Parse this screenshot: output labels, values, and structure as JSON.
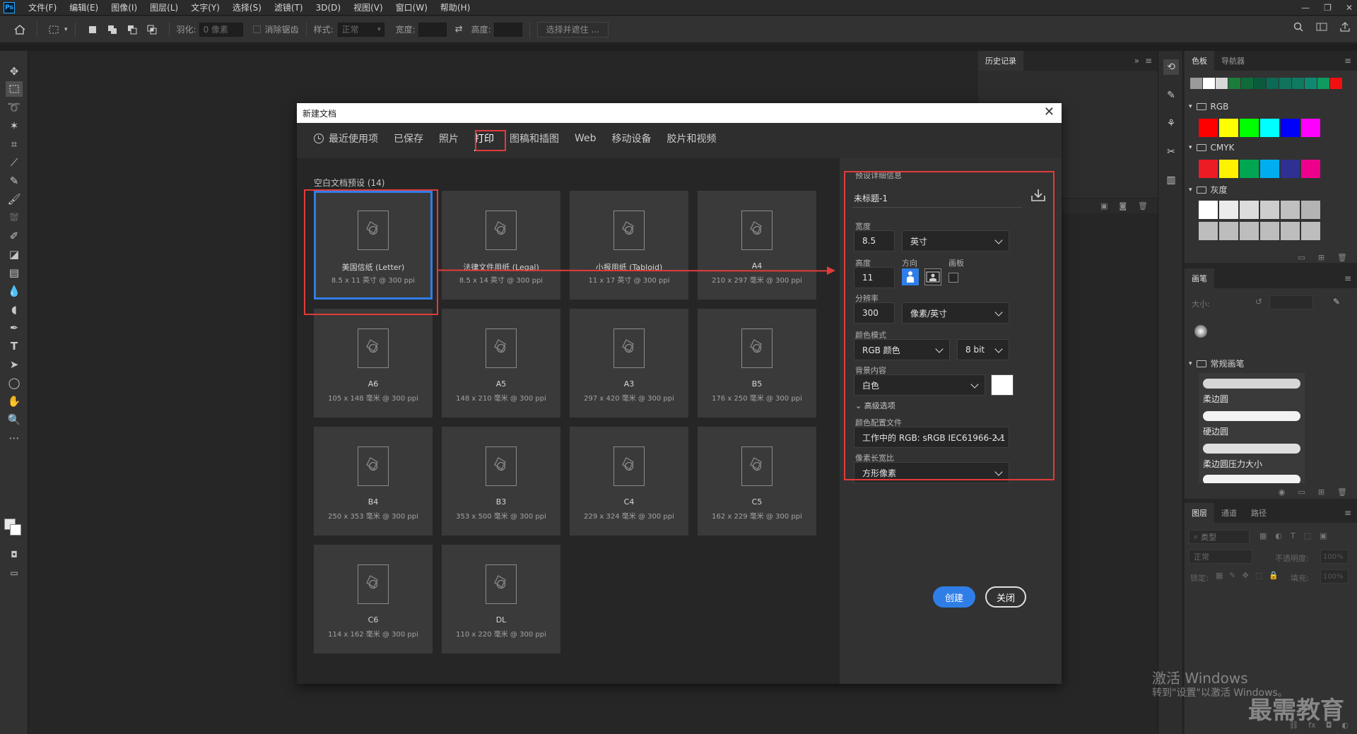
{
  "menubar": {
    "logo": "Ps",
    "items": [
      "文件(F)",
      "编辑(E)",
      "图像(I)",
      "图层(L)",
      "文字(Y)",
      "选择(S)",
      "滤镜(T)",
      "3D(D)",
      "视图(V)",
      "窗口(W)",
      "帮助(H)"
    ],
    "controls": [
      "—",
      "❐",
      "✕"
    ]
  },
  "options": {
    "feather_label": "羽化:",
    "feather_value": "0 像素",
    "antialias_label": "消除锯齿",
    "style_label": "样式:",
    "style_value": "正常",
    "width_label": "宽度:",
    "height_label": "高度:",
    "select_mask_button": "选择并遮住 ..."
  },
  "dialog": {
    "title": "新建文档",
    "tabs": [
      "最近使用项",
      "已保存",
      "照片",
      "打印",
      "图稿和插图",
      "Web",
      "移动设备",
      "胶片和视频"
    ],
    "active_tab": "打印",
    "preset_header": "空白文档预设 (14)",
    "presets": [
      {
        "name": "美国信纸 (Letter)",
        "size": "8.5 x 11 英寸 @ 300 ppi"
      },
      {
        "name": "法律文件用纸 (Legal)",
        "size": "8.5 x 14 英寸 @ 300 ppi"
      },
      {
        "name": "小报用纸 (Tabloid)",
        "size": "11 x 17 英寸 @ 300 ppi"
      },
      {
        "name": "A4",
        "size": "210 x 297 毫米 @ 300 ppi"
      },
      {
        "name": "A6",
        "size": "105 x 148 毫米 @ 300 ppi"
      },
      {
        "name": "A5",
        "size": "148 x 210 毫米 @ 300 ppi"
      },
      {
        "name": "A3",
        "size": "297 x 420 毫米 @ 300 ppi"
      },
      {
        "name": "B5",
        "size": "176 x 250 毫米 @ 300 ppi"
      },
      {
        "name": "B4",
        "size": "250 x 353 毫米 @ 300 ppi"
      },
      {
        "name": "B3",
        "size": "353 x 500 毫米 @ 300 ppi"
      },
      {
        "name": "C4",
        "size": "229 x 324 毫米 @ 300 ppi"
      },
      {
        "name": "C5",
        "size": "162 x 229 毫米 @ 300 ppi"
      },
      {
        "name": "C6",
        "size": "114 x 162 毫米 @ 300 ppi"
      },
      {
        "name": "DL",
        "size": "110 x 220 毫米 @ 300 ppi"
      }
    ],
    "details": {
      "header": "预设详细信息",
      "doc_name": "未标题-1",
      "width_label": "宽度",
      "width_value": "8.5",
      "width_unit": "英寸",
      "height_label": "高度",
      "height_value": "11",
      "orientation_label": "方向",
      "artboard_label": "画板",
      "resolution_label": "分辨率",
      "resolution_value": "300",
      "resolution_unit": "像素/英寸",
      "color_mode_label": "颜色模式",
      "color_mode_value": "RGB 颜色",
      "bit_depth": "8 bit",
      "bg_label": "背景内容",
      "bg_value": "白色",
      "advanced_label": "高级选项",
      "profile_label": "颜色配置文件",
      "profile_value": "工作中的 RGB: sRGB IEC61966-2.1",
      "aspect_label": "像素长宽比",
      "aspect_value": "方形像素",
      "create_button": "创建",
      "close_button": "关闭"
    }
  },
  "history": {
    "tab": "历史记录"
  },
  "swatches": {
    "tabs": [
      "色板",
      "导航器"
    ],
    "groups": [
      "RGB",
      "CMYK",
      "灰度"
    ],
    "recent_colors": [
      "#9a9a9a",
      "#ffffff",
      "#d8d8d8",
      "#1a7d3a",
      "#0f6b3a",
      "#0b5a3c",
      "#0a6a55",
      "#12735d",
      "#0f7a60",
      "#0d8a70",
      "#0f9a60",
      "#f20f0f"
    ],
    "rgb_colors": [
      "#ff0000",
      "#ffff00",
      "#00ff00",
      "#00ffff",
      "#0000ff",
      "#ff00ff"
    ],
    "cmyk_colors": [
      "#ed1c24",
      "#fff200",
      "#00a651",
      "#00aeef",
      "#2e3192",
      "#ec008c"
    ],
    "gray_colors": [
      "#ffffff",
      "#ebebeb",
      "#dcdcdc",
      "#cdcdcd",
      "#c0c0c0",
      "#b3b3b3"
    ]
  },
  "brushes": {
    "tab": "画笔",
    "size_label": "大小:",
    "group": "常规画笔",
    "items": [
      "柔边圆",
      "硬边圆",
      "柔边圆压力大小"
    ]
  },
  "layers": {
    "tabs": [
      "图层",
      "通道",
      "路径"
    ],
    "kind_placeholder": "类型",
    "blend_mode": "正常",
    "opacity_label": "不透明度:",
    "opacity_value": "100%",
    "lock_label": "锁定:",
    "fill_label": "填充:",
    "fill_value": "100%"
  },
  "watermark": {
    "line1": "激活 Windows",
    "line2": "转到\"设置\"以激活 Windows。",
    "brand": "最需教育"
  },
  "colors": {
    "accent": "#2f7ee8",
    "annotation_red": "#e23b3b"
  }
}
